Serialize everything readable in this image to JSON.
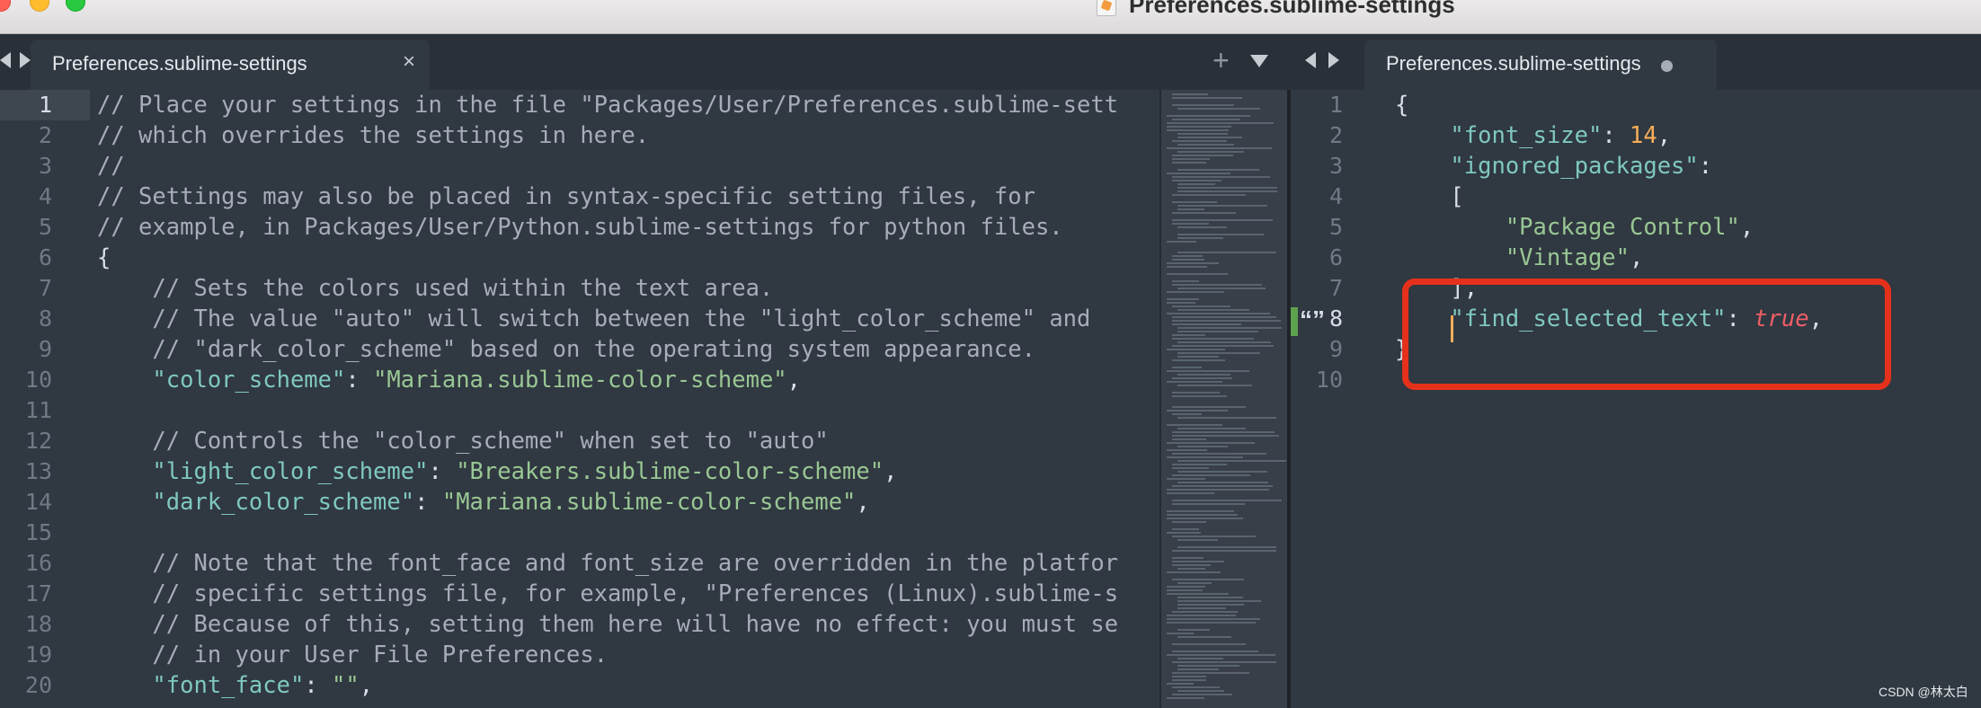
{
  "window": {
    "title": "Preferences.sublime-settings"
  },
  "left_tab": {
    "label": "Preferences.sublime-settings",
    "close_glyph": "×"
  },
  "right_tab": {
    "label": "Preferences.sublime-settings"
  },
  "icons": {
    "plus": "+",
    "quote": "“”"
  },
  "left_editor": {
    "line_numbers": [
      "1",
      "2",
      "3",
      "4",
      "5",
      "6",
      "7",
      "8",
      "9",
      "10",
      "11",
      "12",
      "13",
      "14",
      "15",
      "16",
      "17",
      "18",
      "19",
      "20"
    ],
    "lines": [
      "// Place your settings in the file \"Packages/User/Preferences.sublime-sett",
      "// which overrides the settings in here.",
      "//",
      "// Settings may also be placed in syntax-specific setting files, for",
      "// example, in Packages/User/Python.sublime-settings for python files.",
      "{",
      "    // Sets the colors used within the text area.",
      "    // The value \"auto\" will switch between the \"light_color_scheme\" and",
      "    // \"dark_color_scheme\" based on the operating system appearance.",
      "    \"color_scheme\": \"Mariana.sublime-color-scheme\",",
      "",
      "    // Controls the \"color_scheme\" when set to \"auto\"",
      "    \"light_color_scheme\": \"Breakers.sublime-color-scheme\",",
      "    \"dark_color_scheme\": \"Mariana.sublime-color-scheme\",",
      "",
      "    // Note that the font_face and font_size are overridden in the platfor",
      "    // specific settings file, for example, \"Preferences (Linux).sublime-s",
      "    // Because of this, setting them here will have no effect: you must se",
      "    // in your User File Preferences.",
      "    \"font_face\": \"\","
    ]
  },
  "right_editor": {
    "line_numbers": [
      "1",
      "2",
      "3",
      "4",
      "5",
      "6",
      "7",
      "8",
      "9",
      "10"
    ],
    "lines": [
      "{",
      "    \"font_size\": 14,",
      "    \"ignored_packages\":",
      "    [",
      "        \"Package Control\",",
      "        \"Vintage\",",
      "    ],",
      "    \"find_selected_text\": true,",
      "}",
      ""
    ],
    "current_line": 8
  },
  "watermark": "CSDN @林太白",
  "colors": {
    "background": "#303841",
    "comment": "#a7adba",
    "key": "#7fc8c1",
    "string": "#99c794",
    "number": "#f9ae58",
    "boolean": "#ec5f66",
    "highlight_box": "#e5311b"
  }
}
